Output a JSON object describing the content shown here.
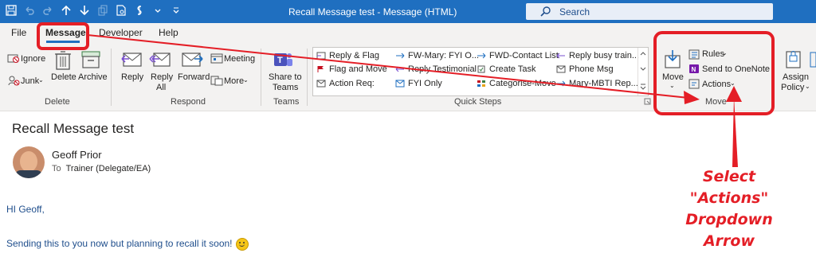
{
  "window": {
    "title": "Recall Message test  -  Message (HTML)",
    "search_placeholder": "Search",
    "qat_icons": [
      "save-icon",
      "undo-icon",
      "redo-icon",
      "up-arrow-icon",
      "down-arrow-icon",
      "copy-icon",
      "print-preview-icon",
      "sensitivity-icon",
      "more-dropdown-icon"
    ]
  },
  "tabs": [
    {
      "label": "File"
    },
    {
      "label": "Message",
      "active": true
    },
    {
      "label": "Developer"
    },
    {
      "label": "Help"
    }
  ],
  "ribbon": {
    "delete_group": {
      "ignore": "Ignore",
      "junk": "Junk",
      "delete": "Delete",
      "archive": "Archive",
      "label": "Delete"
    },
    "respond_group": {
      "reply": "Reply",
      "reply_all_1": "Reply",
      "reply_all_2": "All",
      "forward": "Forward",
      "meeting": "Meeting",
      "more": "More",
      "label": "Respond"
    },
    "teams_group": {
      "share_1": "Share to",
      "share_2": "Teams",
      "label": "Teams"
    },
    "quick_steps": {
      "items": [
        "Reply & Flag",
        "Flag and Move",
        "Action Req:",
        "FW-Mary: FYI O...",
        "Reply Testimonial",
        "FYI Only",
        "FWD-Contact List",
        "Create Task",
        "Categorise-Move",
        "Reply busy train...",
        "Phone Msg",
        "Mary-MBTI Rep..."
      ],
      "label": "Quick Steps"
    },
    "move_group": {
      "move": "Move",
      "rules": "Rules",
      "onenote": "Send to OneNote",
      "actions": "Actions",
      "label": "Move"
    },
    "policy_group": {
      "assign_1": "Assign",
      "assign_2": "Policy"
    }
  },
  "message": {
    "subject": "Recall Message test",
    "sender": "Geoff Prior",
    "to_label": "To",
    "to_value": "Trainer (Delegate/EA)",
    "greeting": "HI Geoff,",
    "body": "Sending this to you now but planning to recall it soon!"
  },
  "annotation": {
    "line1": "Select \"Actions\"",
    "line2": "Dropdown Arrow",
    "color": "#e41e26"
  }
}
